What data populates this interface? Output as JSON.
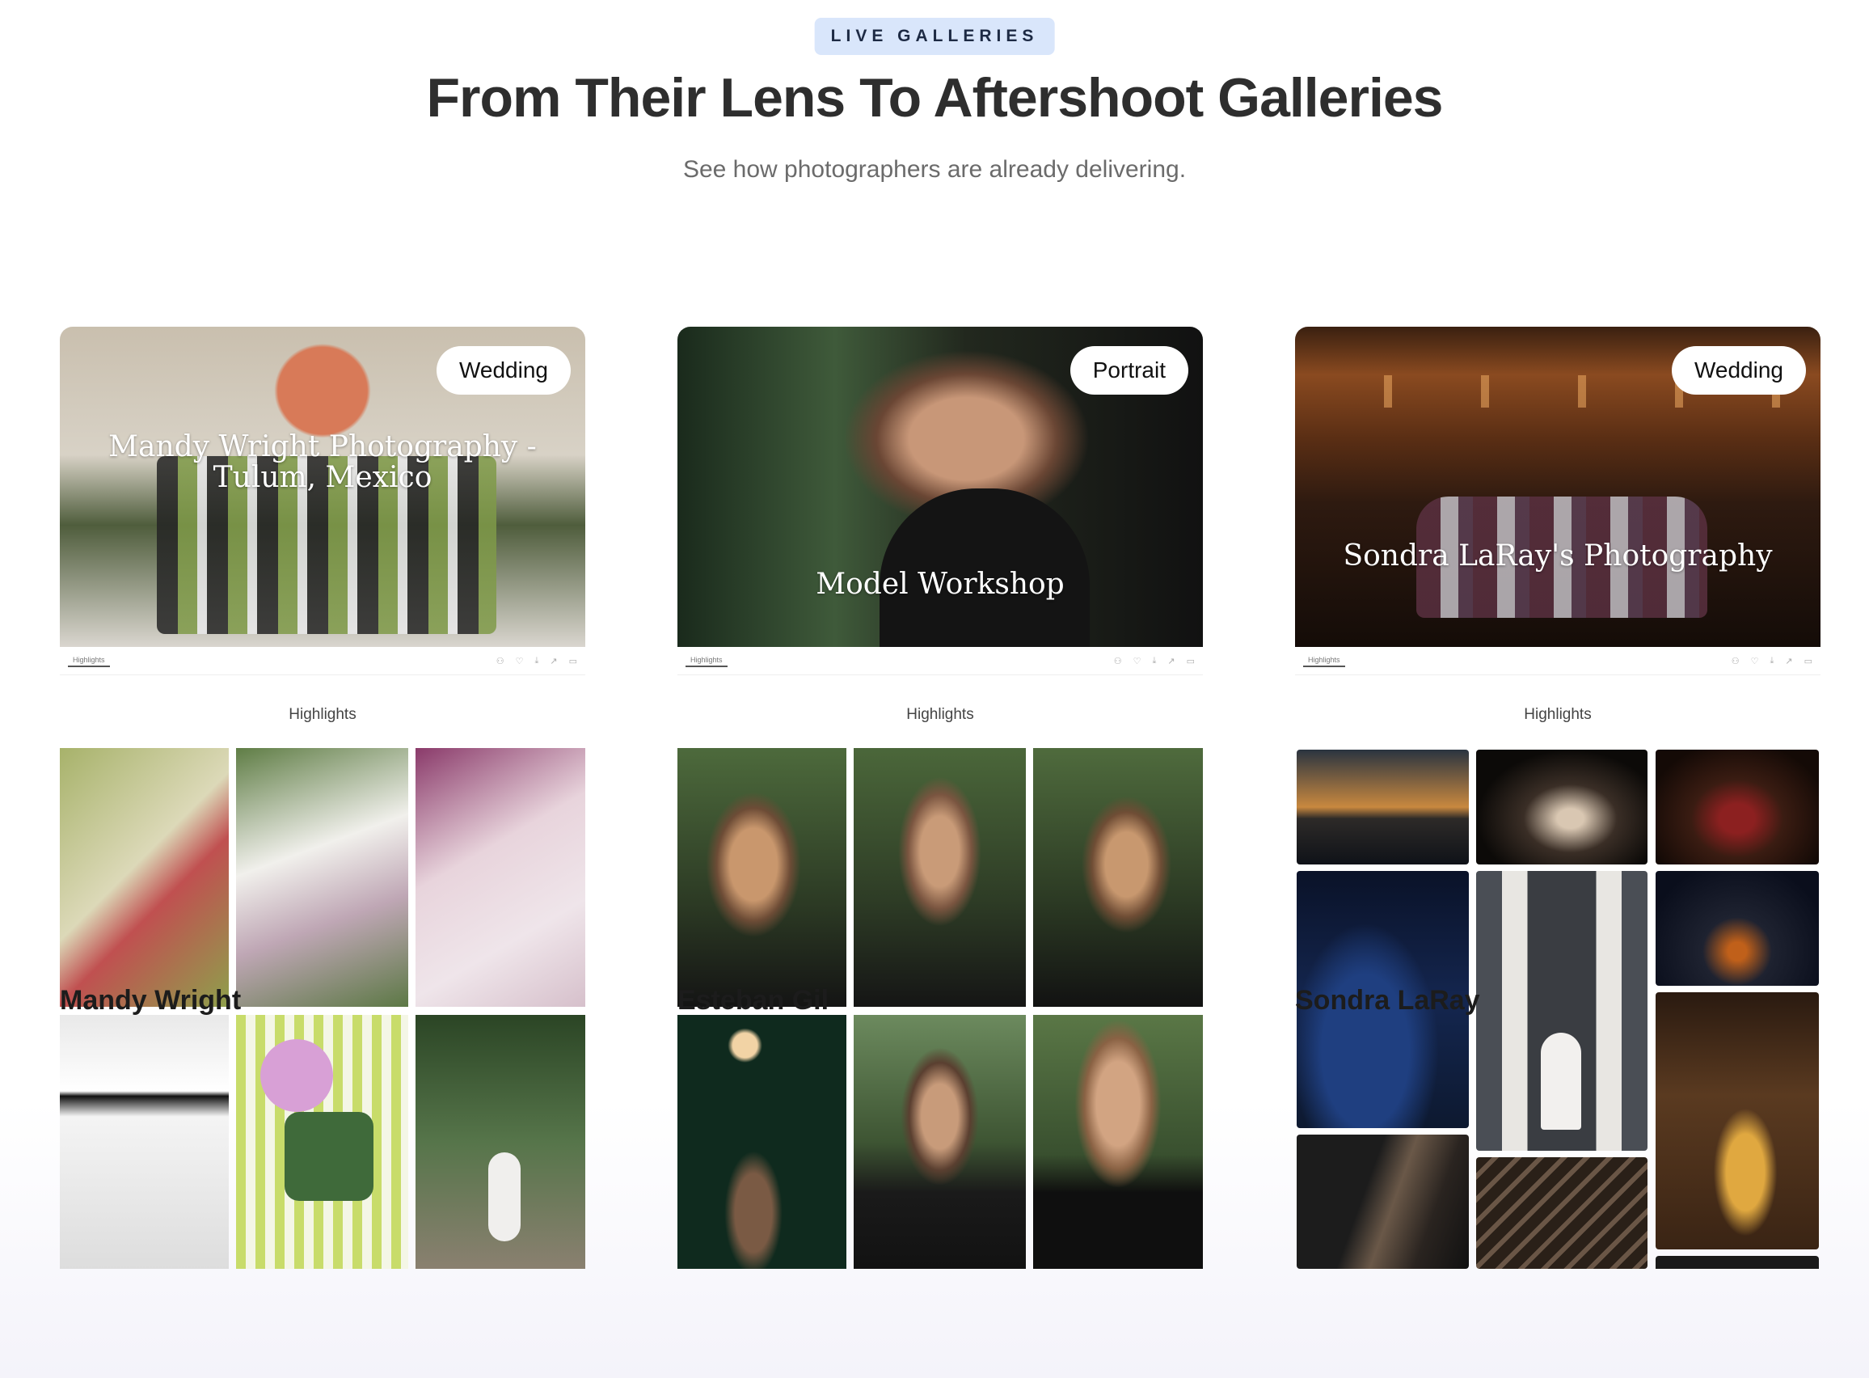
{
  "eyebrow": "LIVE GALLERIES",
  "title": "From Their Lens To Aftershoot Galleries",
  "subtitle": "See how photographers are already delivering.",
  "cards": [
    {
      "category": "Wedding",
      "cover_title": "Mandy Wright Photography - Tulum, Mexico",
      "tab_label": "Highlights",
      "highlights_label": "Highlights",
      "photographer": "Mandy Wright"
    },
    {
      "category": "Portrait",
      "cover_title": "Model Workshop",
      "tab_label": "Highlights",
      "highlights_label": "Highlights",
      "photographer": "Esteban Gil"
    },
    {
      "category": "Wedding",
      "cover_title": "Sondra LaRay's Photography",
      "tab_label": "Highlights",
      "highlights_label": "Highlights",
      "photographer": "Sondra LaRay"
    }
  ],
  "colors": {
    "eyebrow_bg": "#d9e6fb",
    "title": "#2e2e2e",
    "subtitle": "#6b6b6b"
  }
}
